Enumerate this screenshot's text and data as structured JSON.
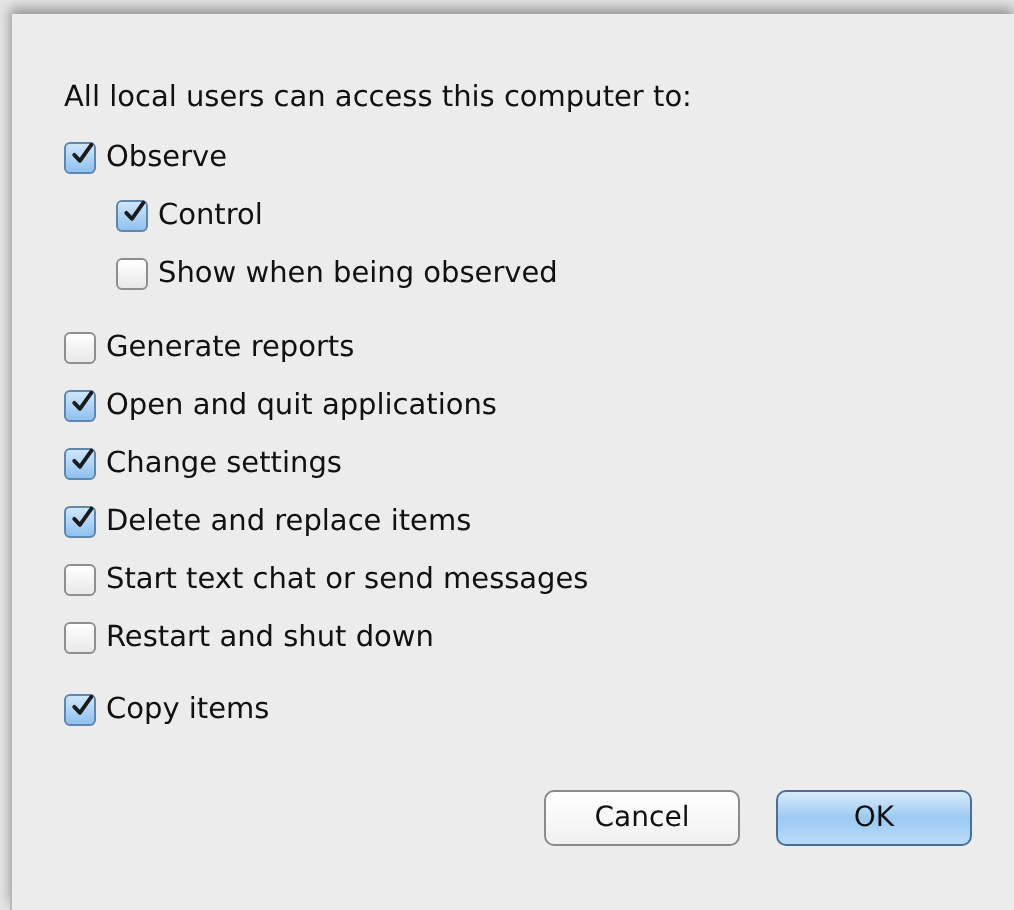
{
  "sheet": {
    "heading": "All local users can access this computer to:",
    "options": [
      {
        "label": "Observe",
        "checked": true,
        "children": [
          {
            "label": "Control",
            "checked": true
          },
          {
            "label": "Show when being observed",
            "checked": false
          }
        ]
      },
      {
        "label": "Generate reports",
        "checked": false
      },
      {
        "label": "Open and quit applications",
        "checked": true
      },
      {
        "label": "Change settings",
        "checked": true
      },
      {
        "label": "Delete and replace items",
        "checked": true
      },
      {
        "label": "Start text chat or send messages",
        "checked": false
      },
      {
        "label": "Restart and shut down",
        "checked": false
      },
      {
        "label": "Copy items",
        "checked": true
      }
    ],
    "buttons": [
      {
        "label": "Cancel",
        "kind": "secondary"
      },
      {
        "label": "OK",
        "kind": "default"
      }
    ]
  }
}
